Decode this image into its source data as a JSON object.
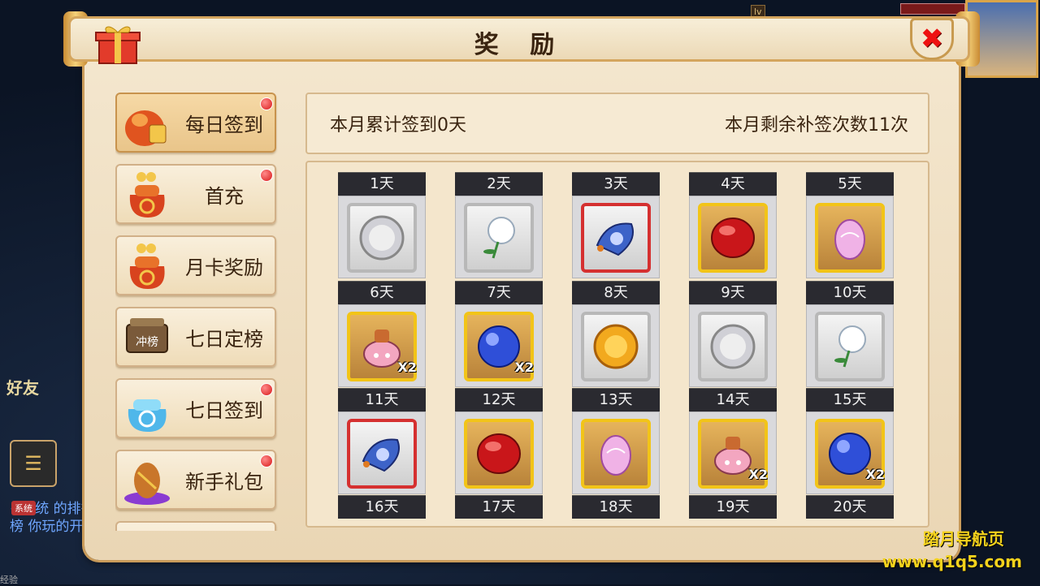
{
  "window": {
    "title": "奖 励"
  },
  "background": {
    "friend_label": "好友",
    "system_tag": "系统",
    "chat_lines": "<系统 的排行榜 你玩的开",
    "exp_label": "经验"
  },
  "sidebar": {
    "items": [
      {
        "label": "每日签到",
        "icon": "red-pouch-icon",
        "active": true,
        "badge": true
      },
      {
        "label": "首充",
        "icon": "treasure-bag-icon",
        "active": false,
        "badge": true
      },
      {
        "label": "月卡奖励",
        "icon": "treasure-bag-icon",
        "active": false,
        "badge": false
      },
      {
        "label": "七日定榜",
        "icon": "ranking-board-icon",
        "active": false,
        "badge": false,
        "icon_text": "冲榜"
      },
      {
        "label": "七日签到",
        "icon": "blue-bag-icon",
        "active": false,
        "badge": true
      },
      {
        "label": "新手礼包",
        "icon": "gift-egg-icon",
        "active": false,
        "badge": true
      }
    ]
  },
  "info": {
    "signed_text": "本月累计签到0天",
    "remaining_text": "本月剩余补签次数11次"
  },
  "days": [
    {
      "label": "1天",
      "item": "silver-coin-icon",
      "frame": "silver",
      "qty": ""
    },
    {
      "label": "2天",
      "item": "dandelion-icon",
      "frame": "silver",
      "qty": ""
    },
    {
      "label": "3天",
      "item": "blue-scroll-icon",
      "frame": "red",
      "qty": ""
    },
    {
      "label": "4天",
      "item": "red-gem-icon",
      "frame": "gold",
      "qty": ""
    },
    {
      "label": "5天",
      "item": "pink-egg-icon",
      "frame": "gold",
      "qty": ""
    },
    {
      "label": "6天",
      "item": "pink-pot-icon",
      "frame": "gold",
      "qty": "X2"
    },
    {
      "label": "7天",
      "item": "blue-orb-icon",
      "frame": "gold",
      "qty": "X2"
    },
    {
      "label": "8天",
      "item": "gold-coin-icon",
      "frame": "silver",
      "qty": ""
    },
    {
      "label": "9天",
      "item": "silver-coin-icon",
      "frame": "silver",
      "qty": ""
    },
    {
      "label": "10天",
      "item": "dandelion-icon",
      "frame": "silver",
      "qty": ""
    },
    {
      "label": "11天",
      "item": "blue-scroll-icon",
      "frame": "red",
      "qty": ""
    },
    {
      "label": "12天",
      "item": "red-gem-icon",
      "frame": "gold",
      "qty": ""
    },
    {
      "label": "13天",
      "item": "pink-egg-icon",
      "frame": "gold",
      "qty": ""
    },
    {
      "label": "14天",
      "item": "pink-pot-icon",
      "frame": "gold",
      "qty": "X2"
    },
    {
      "label": "15天",
      "item": "blue-orb-icon",
      "frame": "gold",
      "qty": "X2"
    },
    {
      "label": "16天",
      "item": "",
      "frame": "",
      "qty": ""
    },
    {
      "label": "17天",
      "item": "",
      "frame": "",
      "qty": ""
    },
    {
      "label": "18天",
      "item": "",
      "frame": "",
      "qty": ""
    },
    {
      "label": "19天",
      "item": "",
      "frame": "",
      "qty": ""
    },
    {
      "label": "20天",
      "item": "",
      "frame": "",
      "qty": ""
    }
  ],
  "watermark": {
    "line1": "踏月导航页",
    "line2": "www.q1q5.com"
  },
  "colors": {
    "accent_gold": "#f2c418",
    "badge_red": "#d81818",
    "close_red": "#e11111"
  }
}
